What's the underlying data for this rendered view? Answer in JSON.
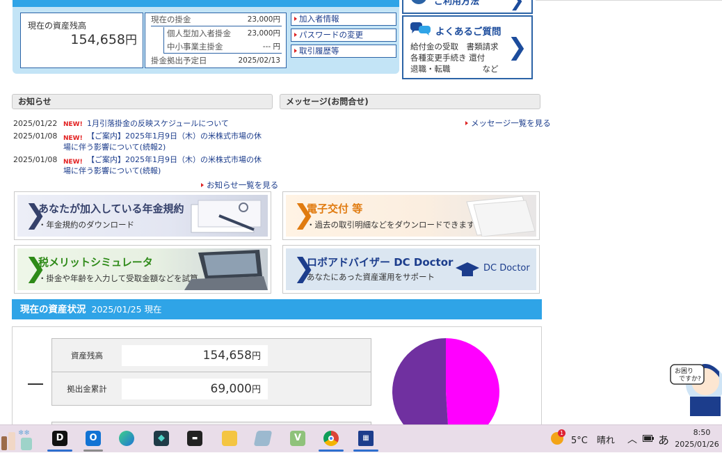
{
  "summary": {
    "balance_label": "現在の資産残高",
    "balance_value": "154,658",
    "yen": "円",
    "current_contrib_label": "現在の掛金",
    "current_contrib_value": "23,000円",
    "individual_label": "個人型加入者掛金",
    "individual_value": "23,000円",
    "smb_label": "中小事業主掛金",
    "smb_value": "--- 円",
    "debit_date_label": "掛金拠出予定日",
    "debit_date_value": "2025/02/13",
    "links": [
      "加入者情報",
      "パスワードの変更",
      "取引履歴等"
    ]
  },
  "help": {
    "howto_title": "ご利用方法",
    "faq_title": "よくあるご質問",
    "faq_lines": [
      "給付金の受取　書類請求",
      "各種変更手続き 還付",
      "退職・転職　　　　など"
    ]
  },
  "news": {
    "header": "お知らせ",
    "new_badge": "NEW!",
    "items": [
      {
        "date": "2025/01/22",
        "title": "1月引落掛金の反映スケジュールについて"
      },
      {
        "date": "2025/01/08",
        "title": "【ご案内】2025年1月9日（木）の米株式市場の休場に伴う影響について(続報2)"
      },
      {
        "date": "2025/01/08",
        "title": "【ご案内】2025年1月9日（木）の米株式市場の休場に伴う影響について(続報)"
      }
    ],
    "more": "お知らせ一覧を見る"
  },
  "messages": {
    "header": "メッセージ(お問合せ)",
    "more": "メッセージ一覧を見る"
  },
  "banners": [
    {
      "title": "あなたが加入している年金規約",
      "sub": "・年金規約のダウンロード",
      "color": "#35416b"
    },
    {
      "title": "電子交付 等",
      "sub": "・過去の取引明細などをダウンロードできます",
      "color": "#e07b10"
    },
    {
      "title": "税メリットシミュレータ",
      "sub": "・掛金や年齢を入力して受取金額などを試算",
      "color": "#2e8a18"
    },
    {
      "title": "ロボアドバイザー DC Doctor",
      "sub": "あなたにあった資産運用をサポート",
      "color": "#1c3d8c",
      "logo": "DC Doctor"
    }
  ],
  "asset": {
    "header": "現在の資産状況",
    "as_of": "2025/01/25 現在",
    "balance_label": "資産残高",
    "balance_value": "154,658",
    "contrib_total_label": "拠出金累計",
    "contrib_total_value": "69,000",
    "yen": "円",
    "pie_colors": [
      "#ff00ff",
      "#7030a0"
    ],
    "pie_fraction_first": 0.49
  },
  "helper": {
    "text": "お困り\nですか?"
  },
  "taskbar": {
    "weather": "5°C　晴れ",
    "weather_badge": "1",
    "ime": "あ",
    "time": "8:50",
    "date": "2025/01/26"
  }
}
